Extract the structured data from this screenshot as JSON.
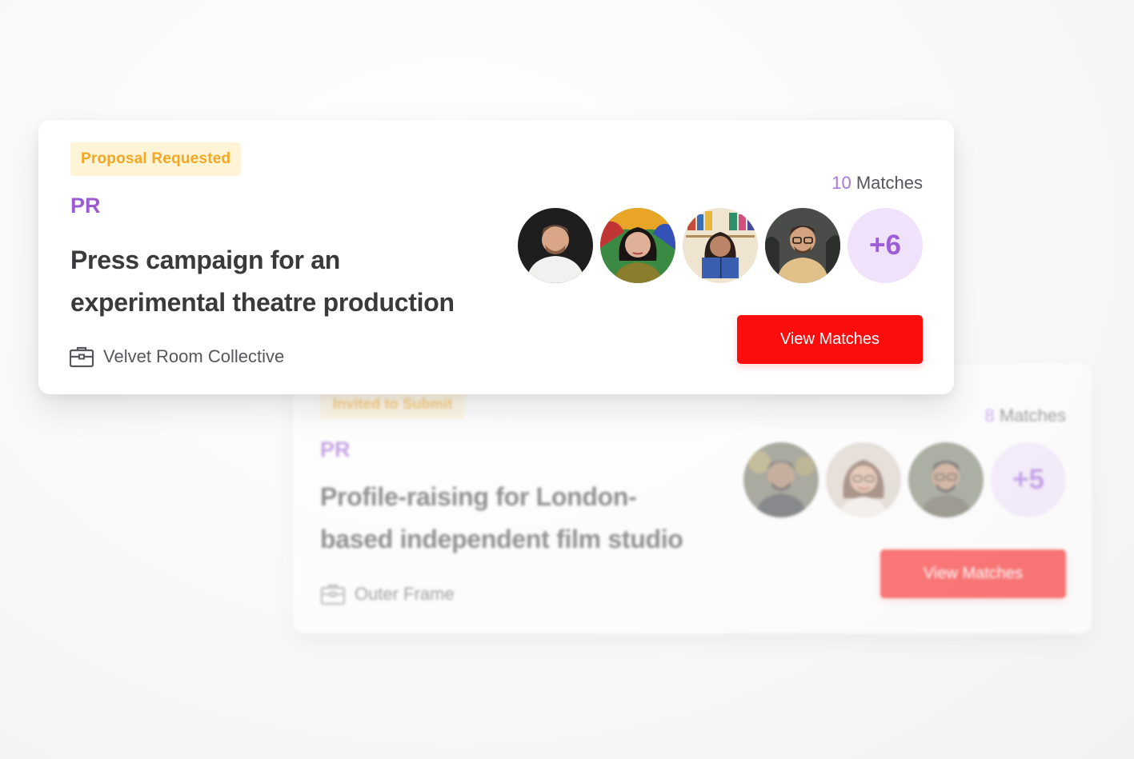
{
  "cards": [
    {
      "status": "Proposal Requested",
      "category": "PR",
      "title_line1": "Press campaign for an",
      "title_line2": "experimental theatre production",
      "organization": "Velvet Room Collective",
      "matches_count": "10",
      "matches_label": " Matches",
      "more_count": "+6",
      "button_label": "View Matches",
      "avatars": [
        "avatar-man-white-shirt",
        "avatar-woman-colorful-background",
        "avatar-woman-reading-book",
        "avatar-man-glasses"
      ]
    },
    {
      "status": "Invited to Submit",
      "category": "PR",
      "title_line1": "Profile-raising for London-",
      "title_line2": "based independent film studio",
      "organization": "Outer Frame",
      "matches_count": "8",
      "matches_label": " Matches",
      "more_count": "+5",
      "button_label": "View Matches",
      "avatars": [
        "avatar-man-beard",
        "avatar-woman-glasses-smiling",
        "avatar-man-glasses-beard"
      ]
    }
  ],
  "colors": {
    "accent_purple": "#9a5cd0",
    "badge_text": "#f5a623",
    "badge_bg": "#fff4d6",
    "button_red": "#fb0d0d",
    "more_bg": "#f0e2fb"
  }
}
